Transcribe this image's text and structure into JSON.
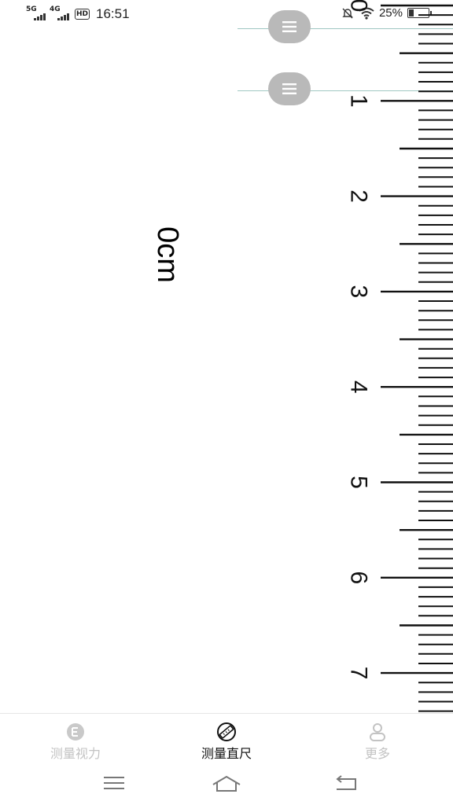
{
  "status_bar": {
    "signal1": "5G",
    "signal2": "4G",
    "hd": "HD",
    "time": "16:51",
    "battery": "25%",
    "battery_level": 0.25
  },
  "reading": "0cm",
  "ruler": {
    "numbers": [
      "0",
      "1",
      "2",
      "3",
      "4",
      "5",
      "6",
      "7"
    ]
  },
  "tabs": [
    {
      "label": "测量视力",
      "icon": "eye-chart-icon",
      "active": false
    },
    {
      "label": "测量直尺",
      "icon": "ruler-icon",
      "active": true
    },
    {
      "label": "更多",
      "icon": "person-icon",
      "active": false
    }
  ],
  "colors": {
    "accent_line": "#9fc7c2",
    "handle": "#b9b9b9",
    "inactive_tab": "#c3c3c3",
    "active_tab": "#111111"
  }
}
